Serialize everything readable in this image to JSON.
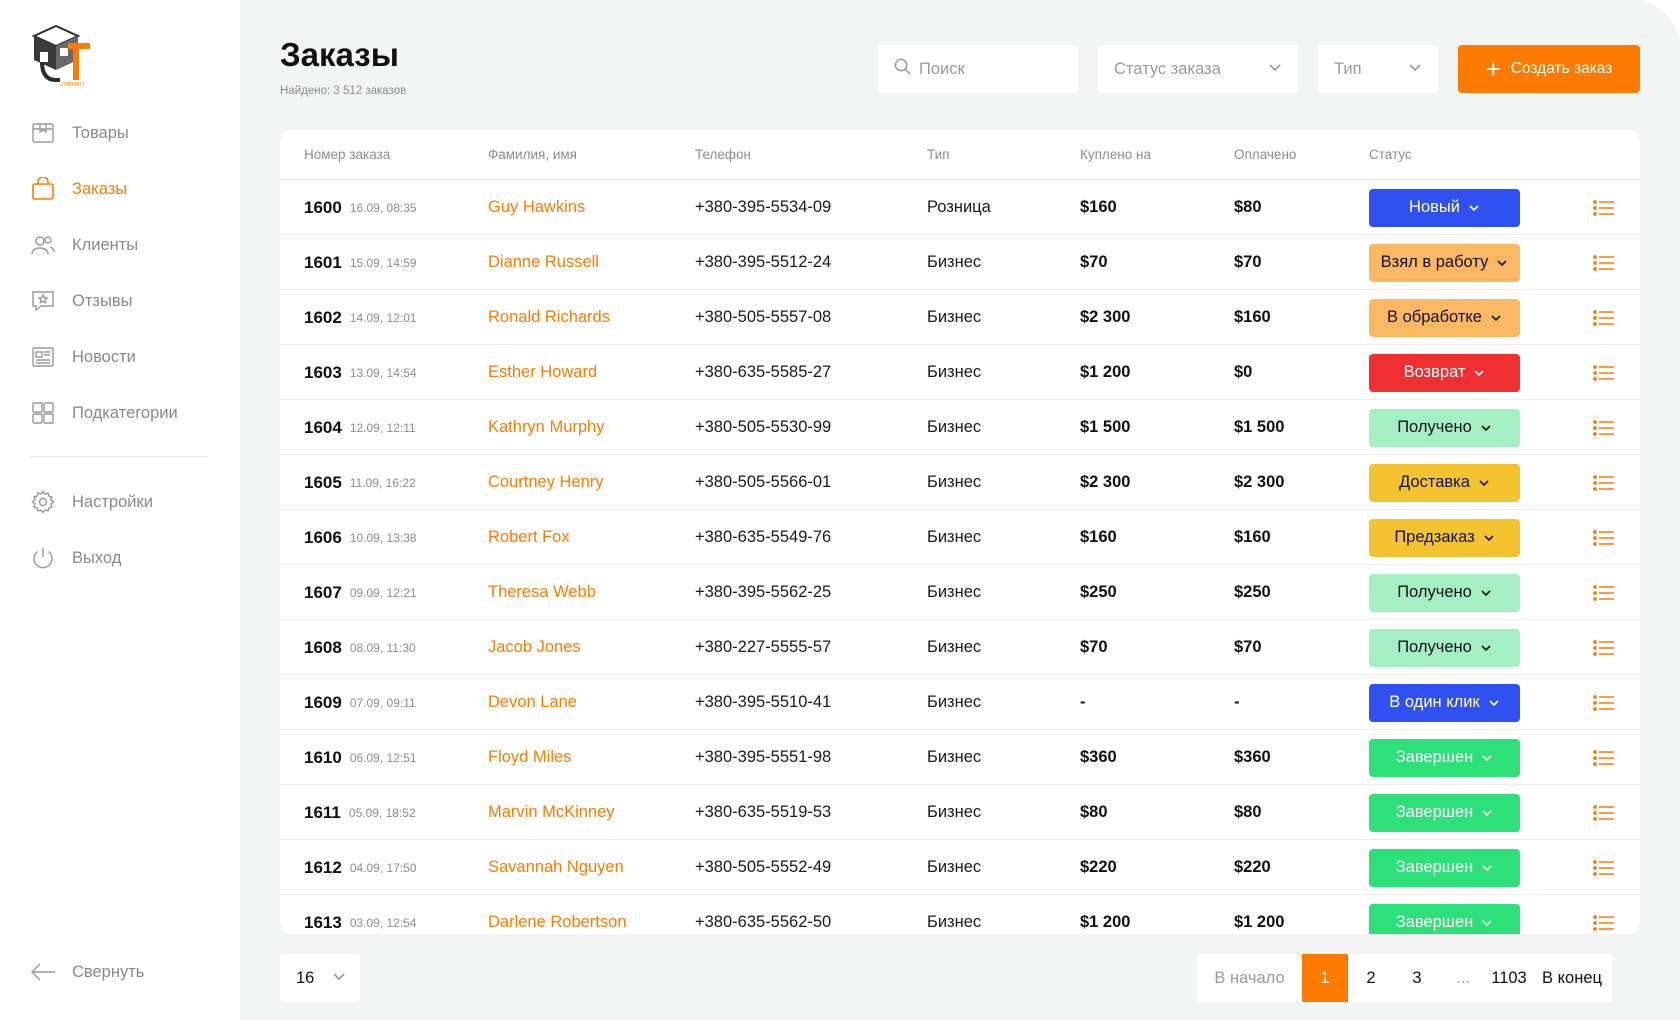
{
  "brand": {
    "logo_text": "COMPANY",
    "accent": "#ff7a00"
  },
  "sidebar": {
    "items": [
      {
        "label": "Товары",
        "icon": "box-icon",
        "active": false
      },
      {
        "label": "Заказы",
        "icon": "shopping-bag-icon",
        "active": true
      },
      {
        "label": "Клиенты",
        "icon": "users-icon",
        "active": false
      },
      {
        "label": "Отзывы",
        "icon": "review-icon",
        "active": false
      },
      {
        "label": "Новости",
        "icon": "newspaper-icon",
        "active": false
      },
      {
        "label": "Подкатегории",
        "icon": "grid-icon",
        "active": false
      }
    ],
    "settings_label": "Настройки",
    "logout_label": "Выход",
    "collapse_label": "Свернуть"
  },
  "header": {
    "title": "Заказы",
    "found": "Найдено: 3 512 заказов",
    "search_placeholder": "Поиск",
    "status_select": "Статус заказа",
    "type_select": "Тип",
    "create_label": "Создать заказ"
  },
  "table": {
    "columns": [
      "Номер заказа",
      "Фамилия, имя",
      "Телефон",
      "Тип",
      "Куплено на",
      "Оплачено",
      "Статус"
    ],
    "rows": [
      {
        "num": "1600",
        "date": "16.09, 08:35",
        "name": "Guy Hawkins",
        "phone": "+380-395-5534-09",
        "type": "Розница",
        "bought": "$160",
        "paid": "$80",
        "status": "Новый",
        "status_color": "blue"
      },
      {
        "num": "1601",
        "date": "15.09, 14:59",
        "name": "Dianne Russell",
        "phone": "+380-395-5512-24",
        "type": "Бизнес",
        "bought": "$70",
        "paid": "$70",
        "status": "Взял в работу",
        "status_color": "orange"
      },
      {
        "num": "1602",
        "date": "14.09, 12:01",
        "name": "Ronald Richards",
        "phone": "+380-505-5557-08",
        "type": "Бизнес",
        "bought": "$2 300",
        "paid": "$160",
        "status": "В обработке",
        "status_color": "orange"
      },
      {
        "num": "1603",
        "date": "13.09, 14:54",
        "name": "Esther Howard",
        "phone": "+380-635-5585-27",
        "type": "Бизнес",
        "bought": "$1 200",
        "paid": "$0",
        "status": "Возврат",
        "status_color": "red"
      },
      {
        "num": "1604",
        "date": "12.09, 12:11",
        "name": "Kathryn Murphy",
        "phone": "+380-505-5530-99",
        "type": "Бизнес",
        "bought": "$1 500",
        "paid": "$1 500",
        "status": "Получено",
        "status_color": "mint"
      },
      {
        "num": "1605",
        "date": "11.09, 16:22",
        "name": "Courtney Henry",
        "phone": "+380-505-5566-01",
        "type": "Бизнес",
        "bought": "$2 300",
        "paid": "$2 300",
        "status": "Доставка",
        "status_color": "yellow"
      },
      {
        "num": "1606",
        "date": "10.09, 13:38",
        "name": "Robert Fox",
        "phone": "+380-635-5549-76",
        "type": "Бизнес",
        "bought": "$160",
        "paid": "$160",
        "status": "Предзаказ",
        "status_color": "yellow"
      },
      {
        "num": "1607",
        "date": "09.09, 12:21",
        "name": "Theresa Webb",
        "phone": "+380-395-5562-25",
        "type": "Бизнес",
        "bought": "$250",
        "paid": "$250",
        "status": "Получено",
        "status_color": "mint"
      },
      {
        "num": "1608",
        "date": "08.09, 11:30",
        "name": "Jacob Jones",
        "phone": "+380-227-5555-57",
        "type": "Бизнес",
        "bought": "$70",
        "paid": "$70",
        "status": "Получено",
        "status_color": "mint"
      },
      {
        "num": "1609",
        "date": "07.09, 09:11",
        "name": "Devon Lane",
        "phone": "+380-395-5510-41",
        "type": "Бизнес",
        "bought": "-",
        "paid": "-",
        "status": "В один клик",
        "status_color": "blue"
      },
      {
        "num": "1610",
        "date": "06.09, 12:51",
        "name": "Floyd Miles",
        "phone": "+380-395-5551-98",
        "type": "Бизнес",
        "bought": "$360",
        "paid": "$360",
        "status": "Завершен",
        "status_color": "green"
      },
      {
        "num": "1611",
        "date": "05.09, 18:52",
        "name": "Marvin McKinney",
        "phone": "+380-635-5519-53",
        "type": "Бизнес",
        "bought": "$80",
        "paid": "$80",
        "status": "Завершен",
        "status_color": "green"
      },
      {
        "num": "1612",
        "date": "04.09, 17:50",
        "name": "Savannah Nguyen",
        "phone": "+380-505-5552-49",
        "type": "Бизнес",
        "bought": "$220",
        "paid": "$220",
        "status": "Завершен",
        "status_color": "green"
      },
      {
        "num": "1613",
        "date": "03.09, 12:54",
        "name": "Darlene Robertson",
        "phone": "+380-635-5562-50",
        "type": "Бизнес",
        "bought": "$1 200",
        "paid": "$1 200",
        "status": "Завершен",
        "status_color": "green"
      }
    ]
  },
  "status_colors": {
    "blue": {
      "bg": "#3050f0",
      "fg": "#ffffff"
    },
    "orange": {
      "bg": "#fbb862",
      "fg": "#111111"
    },
    "red": {
      "bg": "#f03030",
      "fg": "#ffffff"
    },
    "mint": {
      "bg": "#a4f0c4",
      "fg": "#111111"
    },
    "yellow": {
      "bg": "#f4c430",
      "fg": "#111111"
    },
    "green": {
      "bg": "#2ee07a",
      "fg": "#ffffff"
    }
  },
  "footer": {
    "per_page": "16",
    "pages": [
      {
        "label": "В начало",
        "kind": "muted"
      },
      {
        "label": "1",
        "kind": "current"
      },
      {
        "label": "2",
        "kind": "normal"
      },
      {
        "label": "3",
        "kind": "normal"
      },
      {
        "label": "...",
        "kind": "muted"
      },
      {
        "label": "1103",
        "kind": "normal"
      },
      {
        "label": "В конец",
        "kind": "normal"
      }
    ]
  }
}
